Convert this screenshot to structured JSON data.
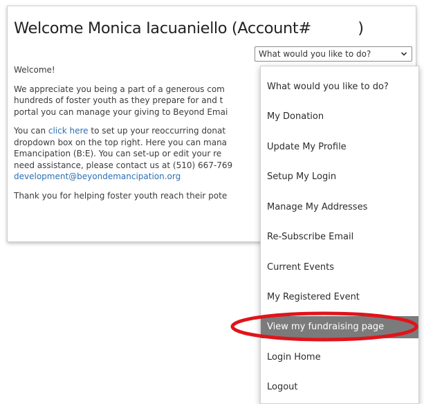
{
  "header": {
    "title": "Welcome Monica Iacuaniello (Account#          )"
  },
  "action_select": {
    "value": "What would you like to do?",
    "chevron_icon": "chevron-down-icon"
  },
  "content": {
    "greeting": "Welcome!",
    "para1": [
      "We appreciate you being a part of a generous com",
      "hundreds of foster youth as they prepare for and t",
      "portal you can manage your giving to Beyond Emai"
    ],
    "para2_prefix": "You can ",
    "para2_link": "click here",
    "para2_first_line_rest": " to set up your reoccurring donat",
    "para2_lines": [
      "dropdown box on the top right. Here you can mana",
      "Emancipation (B:E).  You can set-up or edit your re",
      "need assistance, please contact us at (510) 667-769"
    ],
    "email_link": "development@beyondemancipation.org",
    "para3": "Thank you for helping foster youth reach their pote"
  },
  "menu": {
    "items": [
      {
        "label": "What would you like to do?"
      },
      {
        "label": "My Donation"
      },
      {
        "label": "Update My Profile"
      },
      {
        "label": "Setup My Login"
      },
      {
        "label": "Manage My Addresses"
      },
      {
        "label": "Re-Subscribe Email"
      },
      {
        "label": "Current Events"
      },
      {
        "label": "My Registered Event"
      },
      {
        "label": "View my fundraising page"
      },
      {
        "label": "Login Home"
      },
      {
        "label": "Logout"
      }
    ],
    "highlighted_index": 8,
    "highlight_color": "#7b7b7b",
    "annotation_color": "#e0141b"
  }
}
